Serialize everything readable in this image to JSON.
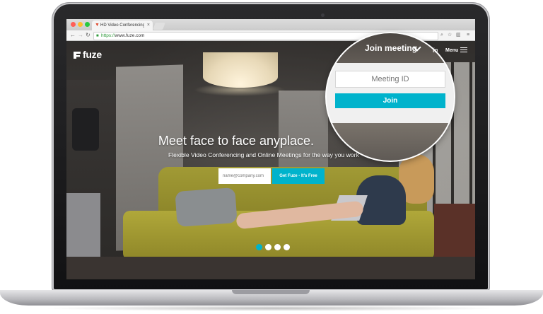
{
  "browser": {
    "tab_title": "HD Video Conferencing ar",
    "tab_close": "×",
    "url_scheme": "https://",
    "url_host": "www.fuze.com"
  },
  "site": {
    "logo_text": "fuze",
    "signin_partial": "in",
    "menu_label": "Menu",
    "hero_title": "Meet face to face anyplace.",
    "hero_subtitle": "Flexible Video Conferencing and Online Meetings for the way you work",
    "email_placeholder": "name@company.com",
    "cta_label": "Get Fuze - It's Free",
    "carousel_active_index": 0,
    "carousel_count": 4
  },
  "magnifier": {
    "left_fragment": "r",
    "join_menu_label": "Join meeting",
    "right_fragment": "In",
    "meeting_id_placeholder": "Meeting ID",
    "join_button_label": "Join"
  },
  "colors": {
    "brand_accent": "#00b3cc"
  }
}
